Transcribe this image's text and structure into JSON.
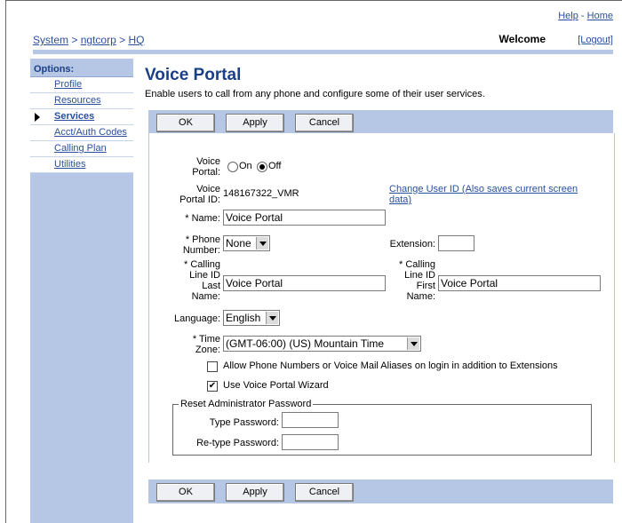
{
  "header": {
    "help": "Help",
    "sep": "-",
    "home": "Home",
    "breadcrumb": [
      "System",
      ">",
      "ngtcorp",
      ">",
      "HQ"
    ],
    "welcome": "Welcome",
    "logout": "[Logout]"
  },
  "sidebar": {
    "title": "Options:",
    "items": [
      {
        "label": "Profile"
      },
      {
        "label": "Resources"
      },
      {
        "label": "Services"
      },
      {
        "label": "Acct/Auth Codes"
      },
      {
        "label": "Calling Plan"
      },
      {
        "label": "Utilities"
      }
    ],
    "active_index": 2
  },
  "page": {
    "title": "Voice Portal",
    "description": "Enable users to call from any phone and configure some of their user services."
  },
  "buttons": {
    "ok": "OK",
    "apply": "Apply",
    "cancel": "Cancel"
  },
  "form": {
    "voice_portal_label": "Voice Portal:",
    "on_label": "On",
    "off_label": "Off",
    "voice_portal_state": "Off",
    "voice_portal_id_label": "Voice Portal ID:",
    "voice_portal_id": "148167322_VMR",
    "change_user_id": "Change User ID (Also saves current screen data)",
    "name_label": "* Name:",
    "name_value": "Voice Portal",
    "phone_label": "* Phone Number:",
    "phone_value": "None",
    "extension_label": "Extension:",
    "extension_value": "",
    "cli_last_label": "* Calling Line ID Last Name:",
    "cli_last_value": "Voice Portal",
    "cli_first_label": "* Calling Line ID First Name:",
    "cli_first_value": "Voice Portal",
    "language_label": "Language:",
    "language_value": "English",
    "timezone_label": "* Time Zone:",
    "timezone_value": "(GMT-06:00) (US) Mountain Time",
    "allow_aliases_label": "Allow Phone Numbers or Voice Mail Aliases on login in addition to Extensions",
    "allow_aliases_checked": false,
    "use_wizard_label": "Use Voice Portal Wizard",
    "use_wizard_checked": true,
    "reset_legend": "Reset Administrator Password",
    "type_password_label": "Type Password:",
    "retype_password_label": "Re-type Password:"
  }
}
